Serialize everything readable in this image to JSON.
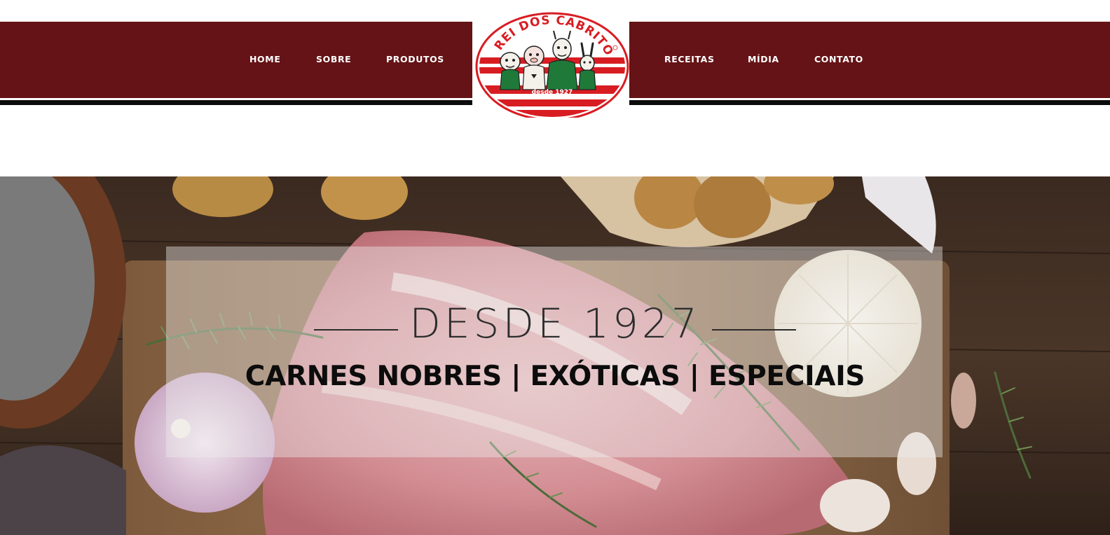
{
  "nav": {
    "left": [
      {
        "label": "HOME"
      },
      {
        "label": "SOBRE"
      },
      {
        "label": "PRODUTOS"
      }
    ],
    "right": [
      {
        "label": "RECEITAS"
      },
      {
        "label": "MÍDIA"
      },
      {
        "label": "CONTATO"
      }
    ]
  },
  "logo": {
    "brand": "O REI DOS CABRITOS",
    "since": "desde 1927"
  },
  "hero": {
    "heading": "DESDE 1927",
    "tagline": "CARNES NOBRES | EXÓTICAS | ESPECIAIS"
  },
  "colors": {
    "nav_bg": "#651316",
    "logo_red": "#d81d22",
    "logo_green": "#1f7a3a"
  }
}
